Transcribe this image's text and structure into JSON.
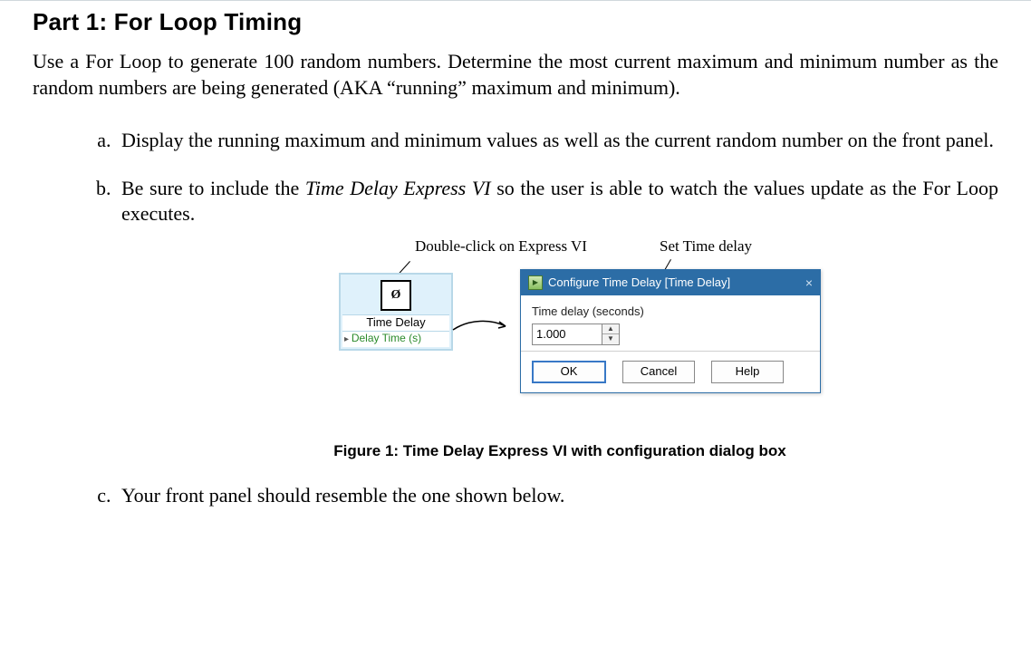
{
  "heading": "Part 1: For Loop Timing",
  "intro": "Use a For Loop to generate 100 random numbers. Determine the most current maximum and minimum number as the random numbers are being generated (AKA “running” maximum and minimum).",
  "items": {
    "a": "Display the running maximum and minimum values as well as the current random number on the front panel.",
    "b_pre": "Be sure to include the ",
    "b_em": "Time Delay Express VI",
    "b_post": " so the user is able to watch the values update as the For Loop executes.",
    "c": "Your front panel should resemble the one shown below."
  },
  "annotations": {
    "dbl": "Double-click on Express VI",
    "set": "Set Time delay"
  },
  "express_vi": {
    "icon_glyph": "Ø",
    "title": "Time Delay",
    "param": "Delay Time (s)"
  },
  "dialog": {
    "title": "Configure Time Delay [Time Delay]",
    "field_label": "Time delay (seconds)",
    "value": "1.000",
    "ok": "OK",
    "cancel": "Cancel",
    "help": "Help"
  },
  "caption": "Figure 1: Time Delay Express VI with configuration dialog box"
}
